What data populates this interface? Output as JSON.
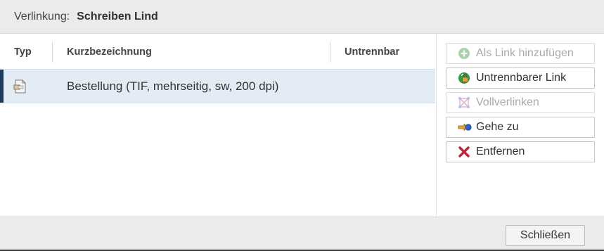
{
  "header": {
    "label": "Verlinkung:",
    "value": "Schreiben Lind"
  },
  "table": {
    "columns": [
      "Typ",
      "Kurzbezeichnung",
      "Untrennbar"
    ],
    "rows": [
      {
        "type_icon": "document-icon",
        "kurzbezeichnung": "Bestellung (TIF, mehrseitig, sw, 200 dpi)",
        "untrennbar": "",
        "selected": true
      }
    ]
  },
  "actions": [
    {
      "label": "Als Link hinzufügen",
      "icon": "add-link-icon",
      "enabled": false
    },
    {
      "label": "Untrennbarer Link",
      "icon": "inseparable-link-icon",
      "enabled": true
    },
    {
      "label": "Vollverlinken",
      "icon": "full-link-icon",
      "enabled": false
    },
    {
      "label": "Gehe zu",
      "icon": "goto-icon",
      "enabled": true
    },
    {
      "label": "Entfernen",
      "icon": "remove-icon",
      "enabled": true
    }
  ],
  "footer": {
    "close_label": "Schließen"
  },
  "colors": {
    "selection_background": "#e3ecf5",
    "selection_accent": "#1f3b5c",
    "remove_red": "#c0213a",
    "add_green": "#3aa04a"
  }
}
